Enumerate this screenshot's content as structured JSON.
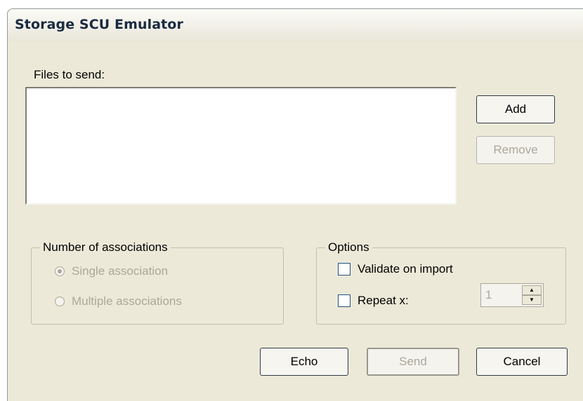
{
  "window": {
    "title": "Storage SCU Emulator"
  },
  "files": {
    "label": "Files to send:",
    "items": []
  },
  "buttons": {
    "add": "Add",
    "remove": "Remove",
    "echo": "Echo",
    "send": "Send",
    "cancel": "Cancel"
  },
  "associations": {
    "legend": "Number of associations",
    "single": "Single association",
    "multiple": "Multiple associations",
    "selected": "single"
  },
  "options": {
    "legend": "Options",
    "validate": "Validate on import",
    "repeat": "Repeat x:",
    "repeat_value": "1",
    "validate_checked": false,
    "repeat_checked": false
  }
}
